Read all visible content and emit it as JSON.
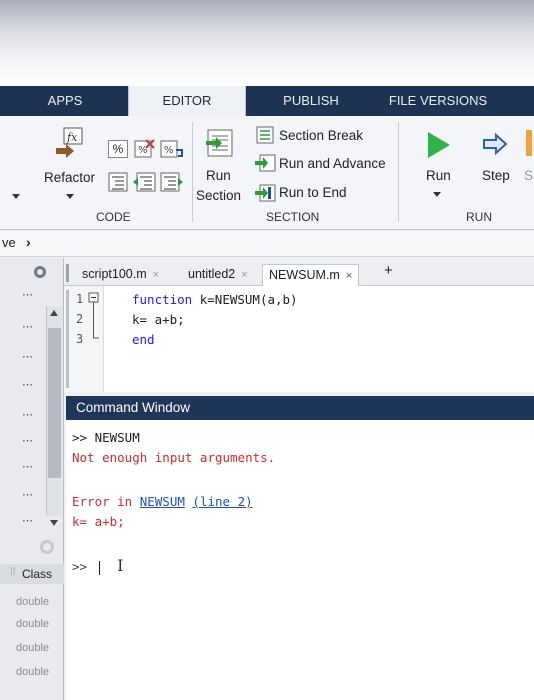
{
  "ribbon_tabs": [
    "APPS",
    "EDITOR",
    "PUBLISH",
    "FILE VERSIONS"
  ],
  "code_group": {
    "refactor_label": "Refactor",
    "group_label": "CODE"
  },
  "section_group": {
    "run_section_label_1": "Run",
    "run_section_label_2": "Section",
    "section_break": "Section Break",
    "run_and_advance": "Run and Advance",
    "run_to_end": "Run to End",
    "group_label": "SECTION"
  },
  "run_group": {
    "run_label": "Run",
    "step_label": "Step",
    "step_cut": "S",
    "group_label": "RUN"
  },
  "address": {
    "prefix": "ve",
    "chevron": "›"
  },
  "workspace": {
    "class_header": "Class",
    "class_items": [
      "double",
      "double",
      "double",
      "double"
    ]
  },
  "editor": {
    "tabs": [
      {
        "name": "script100.m",
        "close": "×"
      },
      {
        "name": "untitled2",
        "close": "×"
      },
      {
        "name": "NEWSUM.m",
        "close": "×"
      }
    ],
    "add_tab": "+",
    "lines": [
      {
        "num": "1",
        "kw": "function",
        "rest": " k=NEWSUM(a,b)"
      },
      {
        "num": "2",
        "kw": "",
        "rest": "k= a+b;"
      },
      {
        "num": "3",
        "kw": "end",
        "rest": ""
      }
    ]
  },
  "command_window": {
    "title": "Command Window",
    "cmd_line": ">> NEWSUM",
    "error_msg": "Not enough input arguments.",
    "error_prefix": "Error in ",
    "error_fn": "NEWSUM",
    "error_line": "(line 2)",
    "error_code": "k= a+b;",
    "prompt": ">>",
    "cursor": "I"
  },
  "colors": {
    "tab_strip": "#1e3251",
    "cw_header": "#1f3658",
    "keyword": "#1a1aff",
    "error": "#d62a2a",
    "link": "#1c4fd6",
    "run_green": "#2fb34a"
  }
}
